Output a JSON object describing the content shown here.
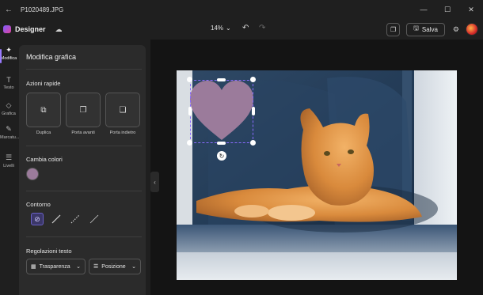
{
  "titlebar": {
    "back_icon": "arrow-left-icon",
    "filename": "P1020489.JPG"
  },
  "toolbar": {
    "app_name": "Designer",
    "zoom": "14%",
    "save_label": "Salva"
  },
  "rail": {
    "items": [
      {
        "label": "Modifica",
        "icon": "sparkle-icon",
        "active": true
      },
      {
        "label": "Testo",
        "icon": "text-icon",
        "active": false
      },
      {
        "label": "Grafica",
        "icon": "shapes-icon",
        "active": false
      },
      {
        "label": "Marcatu...",
        "icon": "pen-icon",
        "active": false
      },
      {
        "label": "Livelli",
        "icon": "layers-icon",
        "active": false
      }
    ]
  },
  "panel": {
    "title": "Modifica grafica",
    "quick_actions_title": "Azioni rapide",
    "quick_actions": [
      {
        "label": "Duplica",
        "icon": "duplicate-icon"
      },
      {
        "label": "Porta avanti",
        "icon": "bring-forward-icon"
      },
      {
        "label": "Porta indietro",
        "icon": "send-backward-icon"
      }
    ],
    "colors_title": "Cambia colori",
    "current_color": "#9b7b9b",
    "outline_title": "Contorno",
    "outline_options": [
      "none-icon",
      "solid-line-icon",
      "dotted-line-icon",
      "thin-line-icon"
    ],
    "text_settings_title": "Regolazioni testo",
    "transparency_label": "Trasparenza",
    "position_label": "Posizione"
  },
  "colors": {
    "accent": "#9a7bff",
    "heart_fill": "#9b7b9b",
    "app_bg": "#1f1f1f",
    "panel_bg": "#2b2b2b",
    "canvas_bg": "#141414"
  }
}
